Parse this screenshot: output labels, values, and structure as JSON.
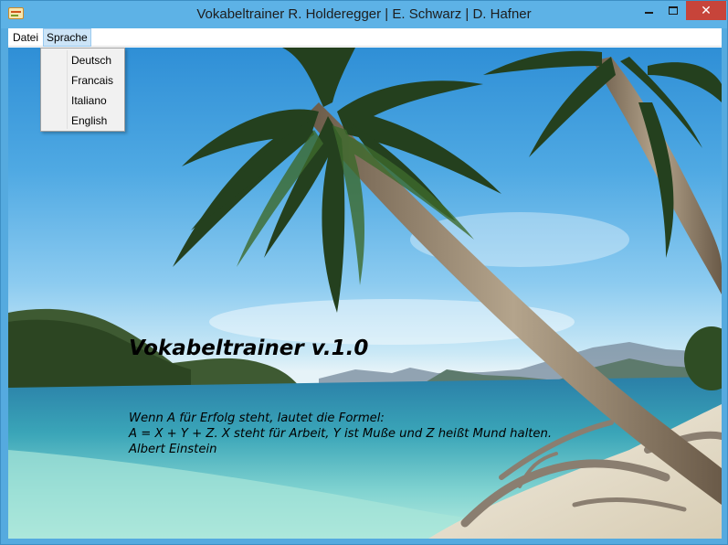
{
  "window": {
    "title": "Vokabeltrainer R. Holderegger | E. Schwarz | D. Hafner",
    "app_icon": "vocabulary-app-icon",
    "controls": {
      "minimize_icon": "minimize-icon",
      "maximize_icon": "maximize-icon",
      "close_icon": "close-icon",
      "close_color": "#c7443a"
    }
  },
  "menubar": {
    "items": [
      {
        "label": "Datei",
        "active": false
      },
      {
        "label": "Sprache",
        "active": true
      }
    ]
  },
  "language_menu": {
    "items": [
      {
        "label": "Deutsch"
      },
      {
        "label": "Francais"
      },
      {
        "label": "Italiano"
      },
      {
        "label": "English"
      }
    ]
  },
  "content": {
    "headline": "Vokabeltrainer v.1.0",
    "quote_lines": [
      "Wenn A für Erfolg steht, lautet die Formel:",
      "A = X + Y + Z. X steht für Arbeit, Y ist Muße und Z heißt Mund halten.",
      "Albert Einstein"
    ],
    "background": "tropical-beach-palm-trees"
  }
}
